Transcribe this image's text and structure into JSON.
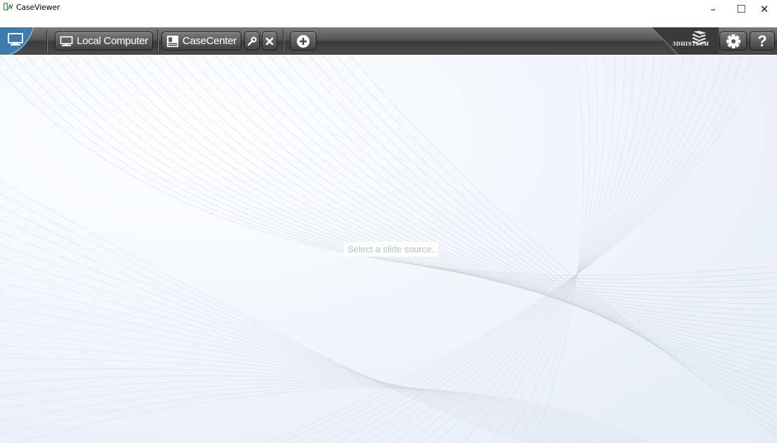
{
  "window": {
    "title": "CaseViewer",
    "controls": {
      "minimize": "–",
      "maximize": "☐",
      "close": "✕"
    }
  },
  "toolbar": {
    "home_icon": "monitor-icon",
    "sources": [
      {
        "label": "Local Computer",
        "icon": "monitor-icon"
      },
      {
        "label": "CaseCenter",
        "icon": "server-icon"
      }
    ],
    "settings_icon": "wrench-icon",
    "remove_icon": "close-icon",
    "add_icon": "plus-circle-icon",
    "logo": {
      "text": "3DHISTECH",
      "icon": "3dhistech-logo"
    },
    "gear_icon": "gear-icon",
    "help_label": "?"
  },
  "main": {
    "message": "Select a slide source."
  },
  "colors": {
    "toolbar": "#4a4a4a",
    "home_tab": "#3f7fb3",
    "background": "#eef1f8"
  }
}
